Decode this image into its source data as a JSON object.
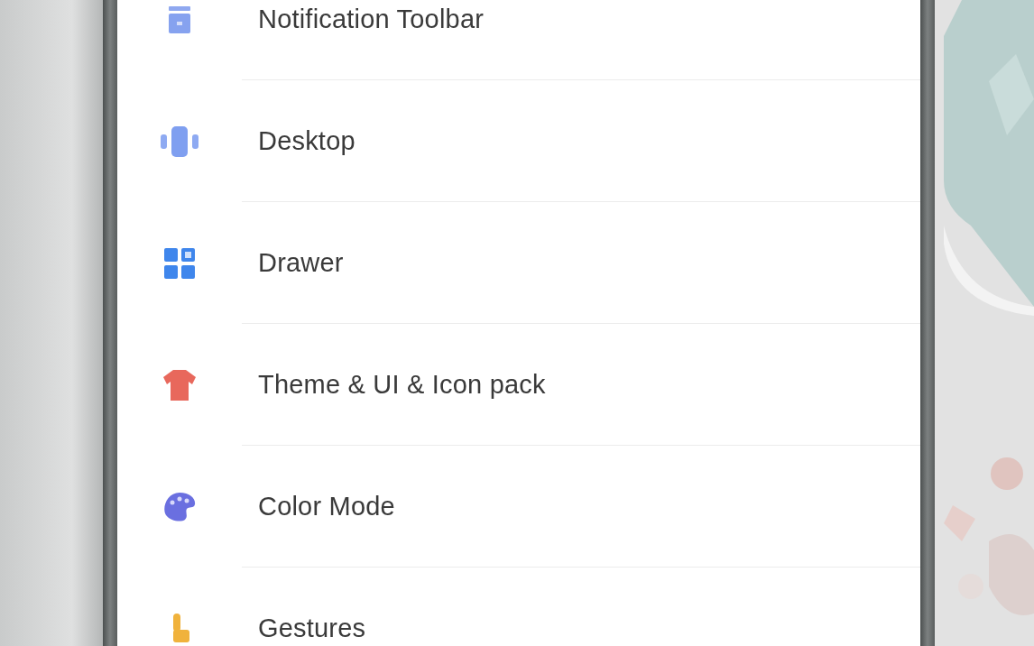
{
  "settings": {
    "items": [
      {
        "label": "Notification Toolbar",
        "kind": "toolbar"
      },
      {
        "label": "Desktop",
        "kind": "desktop"
      },
      {
        "label": "Drawer",
        "kind": "drawer"
      },
      {
        "label": "Theme & UI & Icon pack",
        "kind": "shirt"
      },
      {
        "label": "Color Mode",
        "kind": "palette"
      },
      {
        "label": "Gestures",
        "kind": "gesture"
      }
    ]
  }
}
